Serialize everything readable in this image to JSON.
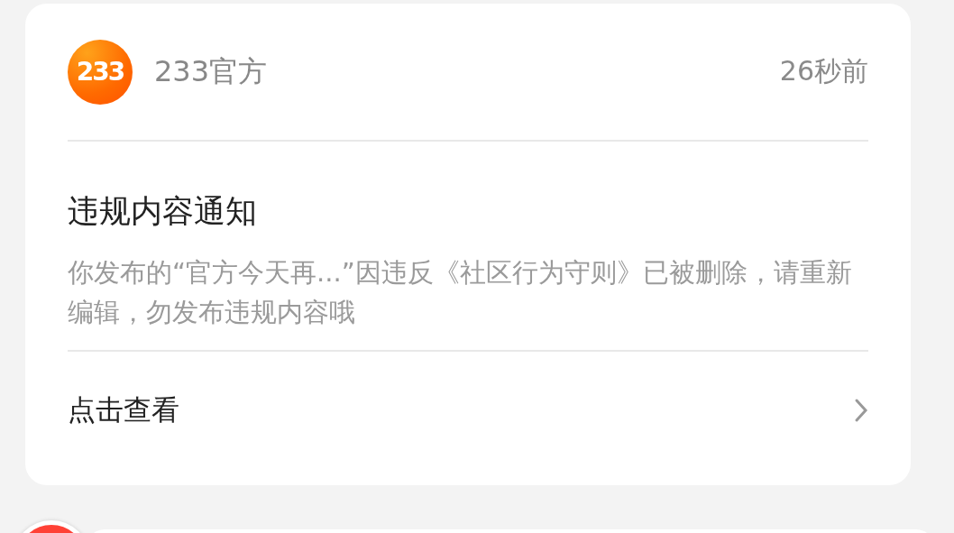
{
  "notification": {
    "sender": {
      "logo_text": "233",
      "name": "233官方"
    },
    "time": "26秒前",
    "title": "违规内容通知",
    "body": "你发布的“官方今天再...”因违反《社区行为守则》已被删除，请重新编辑，勿发布违规内容哦",
    "action": "点击查看"
  }
}
